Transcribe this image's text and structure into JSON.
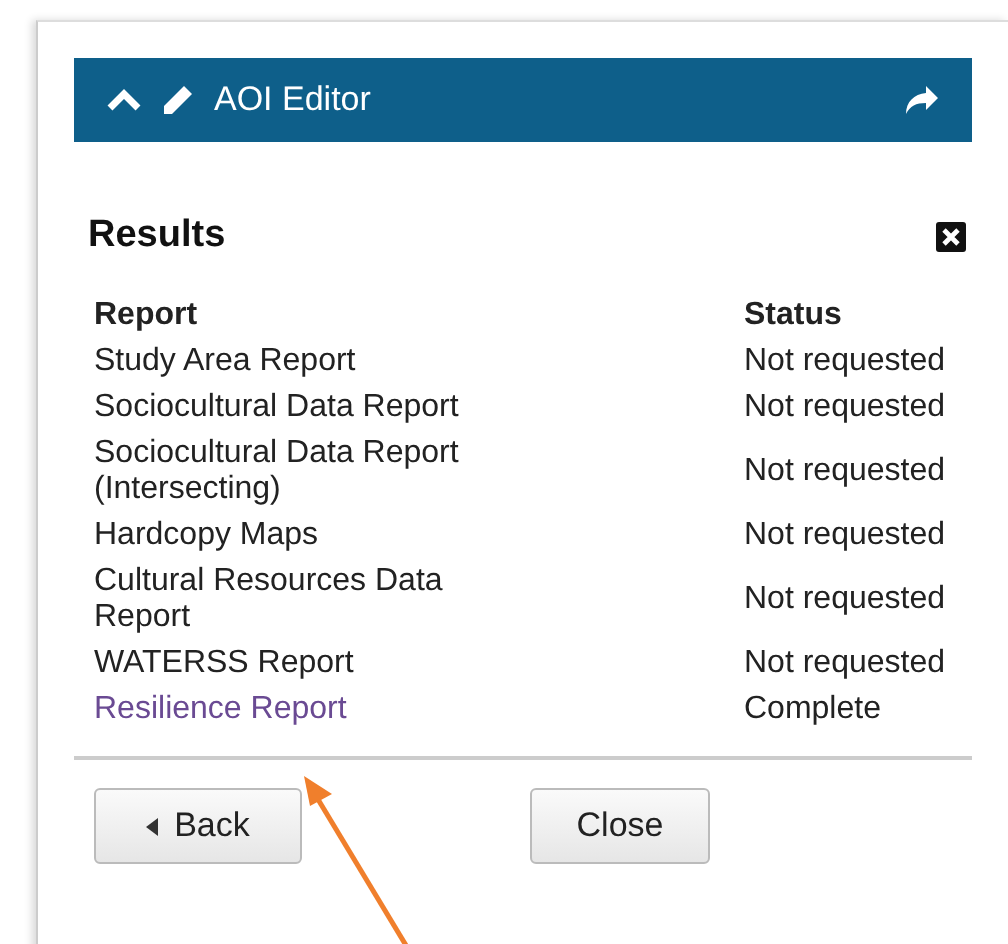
{
  "header": {
    "title": "AOI Editor"
  },
  "results": {
    "title": "Results",
    "columns": [
      "Report",
      "Status"
    ],
    "rows": [
      {
        "report": "Study Area Report",
        "status": "Not requested",
        "linked": false
      },
      {
        "report": "Sociocultural Data Report",
        "status": "Not requested",
        "linked": false
      },
      {
        "report": "Sociocultural Data Report (Intersecting)",
        "status": "Not requested",
        "linked": false
      },
      {
        "report": "Hardcopy Maps",
        "status": "Not requested",
        "linked": false
      },
      {
        "report": "Cultural Resources Data Report",
        "status": "Not requested",
        "linked": false
      },
      {
        "report": "WATERSS Report",
        "status": "Not requested",
        "linked": false
      },
      {
        "report": "Resilience Report",
        "status": "Complete",
        "linked": true
      }
    ]
  },
  "buttons": [
    {
      "label": "Back",
      "kind": "back"
    },
    {
      "label": "Close",
      "kind": "plain"
    }
  ]
}
